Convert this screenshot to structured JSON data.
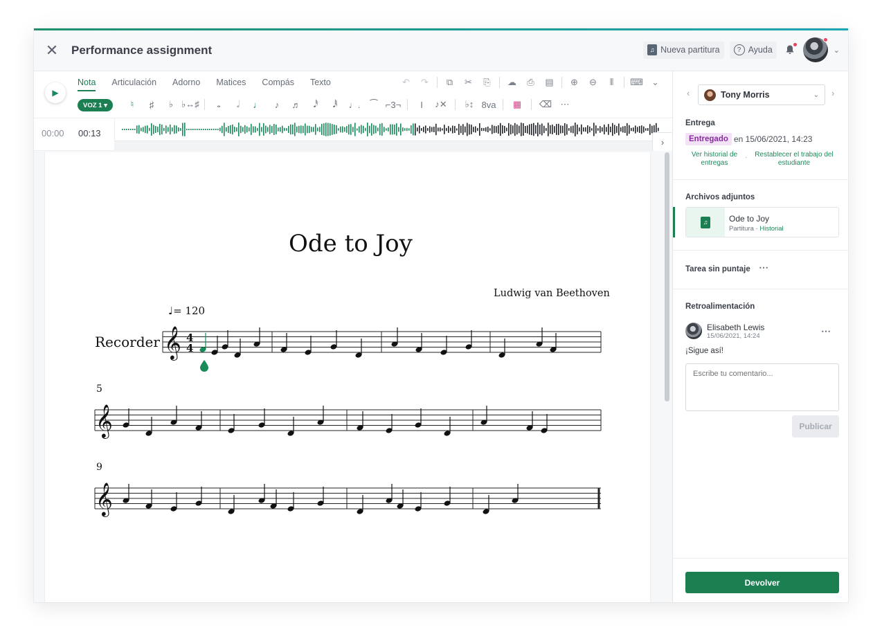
{
  "header": {
    "title": "Performance assignment",
    "new_score_label": "Nueva partitura",
    "help_label": "Ayuda"
  },
  "toolbar": {
    "tabs": [
      "Nota",
      "Articulación",
      "Adorno",
      "Matices",
      "Compás",
      "Texto"
    ],
    "active_tab": "Nota",
    "voice_label": "VOZ 1 ▾"
  },
  "timeline": {
    "start_time": "00:00",
    "current_time": "00:13"
  },
  "score": {
    "title": "Ode to Joy",
    "composer": "Ludwig van Beethoven",
    "tempo": "= 120",
    "instrument": "Recorder",
    "measure_numbers": [
      "5",
      "9"
    ]
  },
  "side": {
    "student_name": "Tony Morris",
    "delivery_heading": "Entrega",
    "status_badge": "Entregado",
    "status_date": "en 15/06/2021, 14:23",
    "link_history": "Ver historial de entregas",
    "link_restore": "Restablecer el trabajo del estudiante",
    "attachments_heading": "Archivos adjuntos",
    "attachment_name": "Ode to Joy",
    "attachment_meta": "Partitura · ",
    "attachment_history": "Historial",
    "ungraded_label": "Tarea sin puntaje",
    "feedback_heading": "Retroalimentación",
    "feedback_author": "Elisabeth Lewis",
    "feedback_date": "15/06/2021, 14:24",
    "feedback_text": "¡Sigue así!",
    "comment_placeholder": "Escribe tu comentario...",
    "publish_label": "Publicar",
    "return_label": "Devolver"
  },
  "colors": {
    "accent": "#1b7f52",
    "badge_bg": "#f2e4f6",
    "badge_text": "#8a2aa0",
    "notification": "#e8455d"
  },
  "icons": [
    "close-icon",
    "new-score-icon",
    "help-icon",
    "bell-icon",
    "play-icon",
    "chevron-right-icon",
    "chevron-left-icon",
    "more-icon"
  ]
}
